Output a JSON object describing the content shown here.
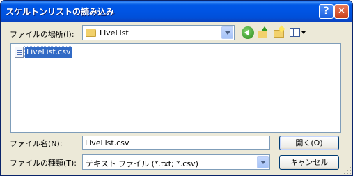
{
  "window": {
    "title": "スケルトンリストの読み込み",
    "help_glyph": "?",
    "close_glyph": "✕"
  },
  "location": {
    "label": "ファイルの場所(I):",
    "value": "LiveList"
  },
  "toolbar": {
    "icons": [
      "back-icon",
      "up-folder-icon",
      "new-folder-icon",
      "views-menu-icon"
    ]
  },
  "file_list": {
    "items": [
      {
        "name": "LiveList.csv",
        "icon": "csv-file-icon",
        "selected": true
      }
    ]
  },
  "filename": {
    "label": "ファイル名(N):",
    "value": "LiveList.csv"
  },
  "filetype": {
    "label": "ファイルの種類(T):",
    "value": "テキスト ファイル (*.txt; *.csv)"
  },
  "buttons": {
    "open": "開く(O)",
    "cancel": "キャンセル"
  },
  "colors": {
    "title_bar": "#0054e3",
    "selection": "#316ac5",
    "dialog_bg": "#ece9d8"
  }
}
